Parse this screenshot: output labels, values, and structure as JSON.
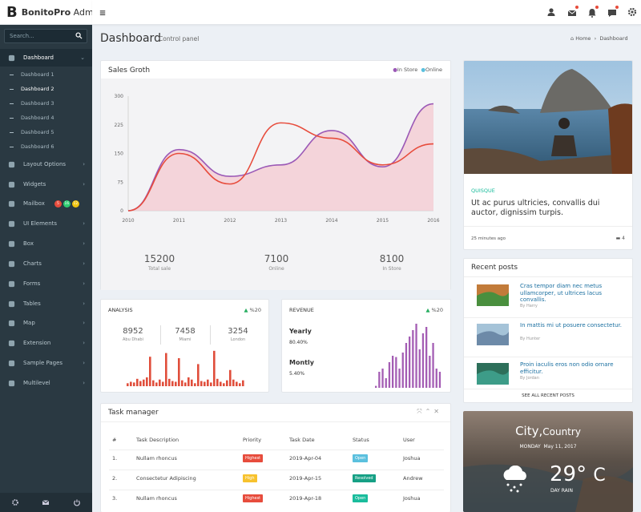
{
  "brand": {
    "letter": "B",
    "name": "BonitoPro",
    "suffix": "Admin"
  },
  "sidebar": {
    "search_placeholder": "Search...",
    "items": [
      {
        "label": "Dashboard",
        "icon": "palette-icon"
      },
      {
        "label": "Layout Options",
        "icon": "layers-icon"
      },
      {
        "label": "Widgets",
        "icon": "widgets-icon"
      },
      {
        "label": "Mailbox",
        "icon": "mailbox-icon"
      },
      {
        "label": "UI Elements",
        "icon": "ui-elements-icon"
      },
      {
        "label": "Box",
        "icon": "box-icon"
      },
      {
        "label": "Charts",
        "icon": "pie-chart-icon"
      },
      {
        "label": "Forms",
        "icon": "edit-icon"
      },
      {
        "label": "Tables",
        "icon": "table-icon"
      },
      {
        "label": "Map",
        "icon": "map-icon"
      },
      {
        "label": "Extension",
        "icon": "extension-icon"
      },
      {
        "label": "Sample Pages",
        "icon": "pages-icon"
      },
      {
        "label": "Multilevel",
        "icon": "share-icon"
      }
    ],
    "subitems": [
      "Dashboard 1",
      "Dashboard 2",
      "Dashboard 3",
      "Dashboard 4",
      "Dashboard 5",
      "Dashboard 6"
    ],
    "mail_badges": [
      {
        "text": "5",
        "color": "#e74c3c"
      },
      {
        "text": "16",
        "color": "#2ecc71"
      },
      {
        "text": "12",
        "color": "#f1c40f"
      }
    ]
  },
  "page": {
    "title": "Dashboard",
    "subtitle": "Control panel",
    "breadcrumb_home": "Home",
    "breadcrumb_current": "Dashboard"
  },
  "sales": {
    "title": "Sales Groth",
    "legend": [
      "In Store",
      "Online"
    ],
    "stats": [
      {
        "value": "15200",
        "label": "Total sale"
      },
      {
        "value": "7100",
        "label": "Online"
      },
      {
        "value": "8100",
        "label": "In Store"
      }
    ]
  },
  "chart_data": {
    "type": "line",
    "title": "Sales Groth",
    "x": [
      "2010",
      "2011",
      "2012",
      "2013",
      "2014",
      "2015",
      "2016"
    ],
    "ylim": [
      0,
      300
    ],
    "yticks": [
      "0",
      "75",
      "150",
      "225",
      "300"
    ],
    "series": [
      {
        "name": "In Store",
        "color": "#9b59b6",
        "values": [
          0,
          160,
          90,
          120,
          210,
          115,
          280
        ]
      },
      {
        "name": "Online",
        "color": "#e74c3c",
        "values": [
          0,
          150,
          70,
          230,
          190,
          120,
          175
        ]
      }
    ]
  },
  "analysis": {
    "title": "ANALYSIS",
    "trend": "%20",
    "stats": [
      {
        "value": "8952",
        "label": "Abu Dhabi"
      },
      {
        "value": "7458",
        "label": "Miami"
      },
      {
        "value": "3254",
        "label": "London"
      }
    ],
    "bars": [
      4,
      6,
      5,
      10,
      7,
      9,
      12,
      40,
      8,
      5,
      9,
      6,
      45,
      10,
      7,
      6,
      38,
      8,
      5,
      12,
      9,
      4,
      30,
      7,
      6,
      9,
      5,
      48,
      10,
      6,
      4,
      8,
      22,
      9,
      6,
      4,
      8
    ]
  },
  "revenue": {
    "title": "REVENUE",
    "trend": "%20",
    "yearly_label": "Yearly",
    "yearly_value": "80.40%",
    "monthly_label": "Montly",
    "monthly_value": "5.40%",
    "bars": [
      3,
      25,
      30,
      15,
      40,
      50,
      48,
      30,
      55,
      70,
      80,
      90,
      100,
      60,
      85,
      95,
      50,
      70,
      30,
      25
    ]
  },
  "tasks": {
    "title": "Task manager",
    "columns": [
      "#",
      "Task Description",
      "Priority",
      "Task Date",
      "Status",
      "User"
    ],
    "rows": [
      {
        "n": "1.",
        "desc": "Nullam rhoncus",
        "priority": "Highest",
        "pcolor": "#e74c3c",
        "date": "2019-Apr-04",
        "status": "Open",
        "scolor": "#5bc0de",
        "user": "Joshua"
      },
      {
        "n": "2.",
        "desc": "Consectetur Adipiscing",
        "priority": "High",
        "pcolor": "#f7c22e",
        "date": "2019-Apr-15",
        "status": "Resolved",
        "scolor": "#16a085",
        "user": "Andrew"
      },
      {
        "n": "3.",
        "desc": "Nullam rhoncus",
        "priority": "Highest",
        "pcolor": "#e74c3c",
        "date": "2019-Apr-18",
        "status": "Open",
        "scolor": "#1abc9c",
        "user": "Joshua"
      }
    ]
  },
  "feature": {
    "tag": "QUISQUE",
    "text": "Ut ac purus ultricies, convallis dui auctor, dignissim turpis.",
    "time": "25 minutes ago",
    "comments": "4"
  },
  "recent": {
    "title": "Recent posts",
    "footer": "SEE ALL RECENT POSTS",
    "posts": [
      {
        "title": "Cras tempor diam nec metus ullamcorper, ut ultrices lacus convallis.",
        "author": "By Harry"
      },
      {
        "title": "In mattis mi ut posuere consectetur.",
        "author": "By Hunter"
      },
      {
        "title": "Proin iaculis eros non odio ornare efficitur.",
        "author": "By Jordan"
      }
    ]
  },
  "weather": {
    "city": "City",
    "country": "Country",
    "day": "MONDAY",
    "date": "May 11, 2017",
    "temp": "29°",
    "unit": "C",
    "condition": "DAY RAIN"
  }
}
